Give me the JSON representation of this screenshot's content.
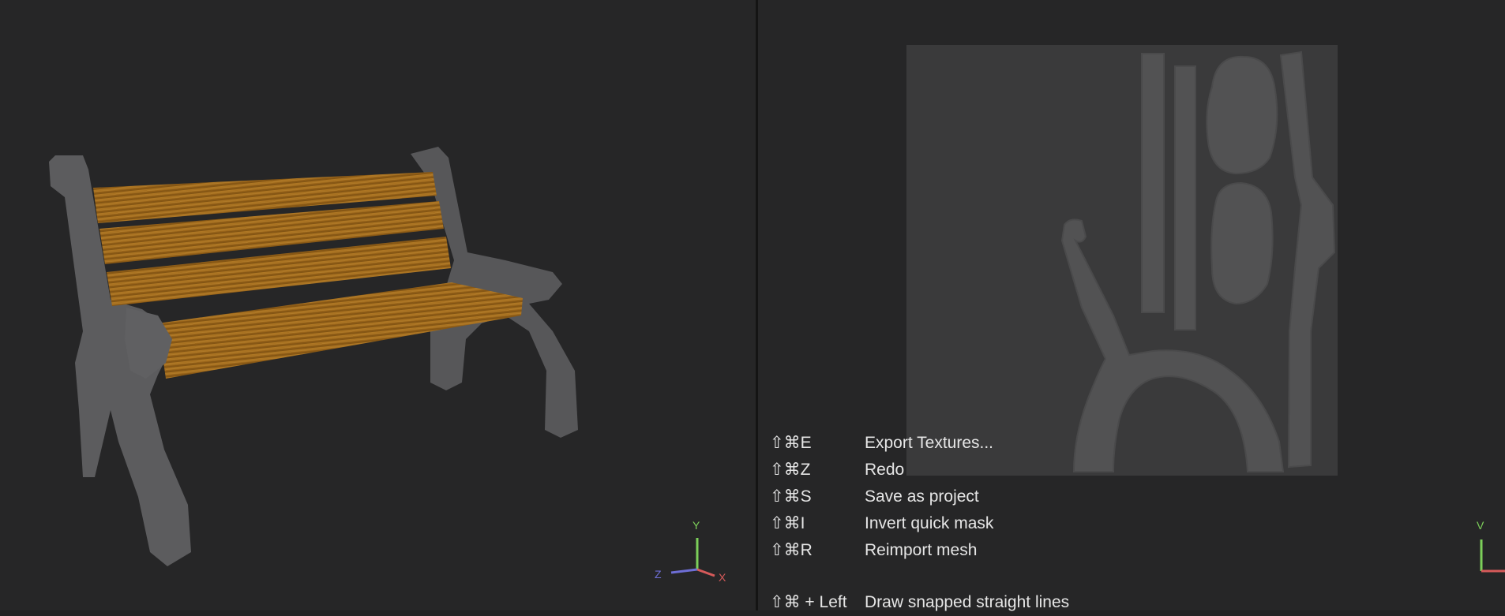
{
  "viewport_3d": {
    "gizmo": {
      "y_label": "Y",
      "z_label": "Z",
      "x_label": "X"
    }
  },
  "viewport_uv": {
    "gizmo": {
      "v_label": "V"
    }
  },
  "shortcuts": [
    {
      "key": "⇧⌘E",
      "action": "Export Textures..."
    },
    {
      "key": "⇧⌘Z",
      "action": "Redo"
    },
    {
      "key": "⇧⌘S",
      "action": "Save as project"
    },
    {
      "key": "⇧⌘I",
      "action": "Invert quick mask"
    },
    {
      "key": "⇧⌘R",
      "action": "Reimport mesh"
    },
    {
      "key": "⇧⌘ + Left",
      "action": "Draw snapped straight lines"
    }
  ],
  "colors": {
    "background": "#262627",
    "wood": "#a8711f",
    "frame": "#5c5c5e",
    "uv_canvas": "#3a3a3b",
    "uv_island": "#525253",
    "axis_x": "#d65a5a",
    "axis_y": "#7ccf5a",
    "axis_z": "#6e6ed6"
  }
}
